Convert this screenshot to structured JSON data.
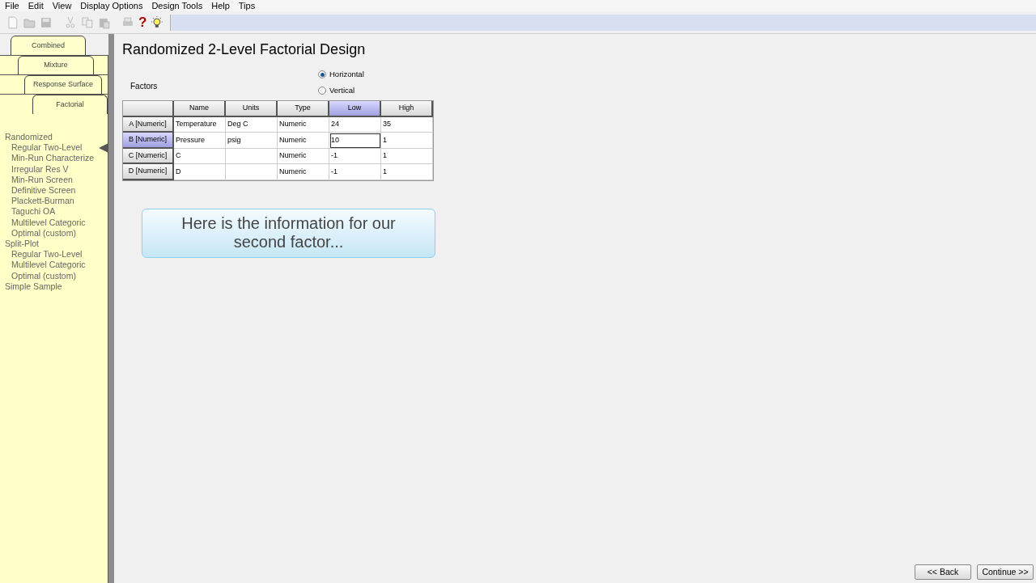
{
  "menu": [
    "File",
    "Edit",
    "View",
    "Display Options",
    "Design Tools",
    "Help",
    "Tips"
  ],
  "toolbar": [
    {
      "kind": "new",
      "disabled": true
    },
    {
      "kind": "open",
      "disabled": true
    },
    {
      "kind": "save",
      "disabled": true
    },
    {
      "kind": "cut",
      "disabled": true
    },
    {
      "kind": "copy",
      "disabled": true
    },
    {
      "kind": "paste",
      "disabled": true
    },
    {
      "kind": "print",
      "disabled": true
    },
    {
      "kind": "help",
      "disabled": false,
      "text": "?"
    },
    {
      "kind": "tip",
      "disabled": false
    }
  ],
  "tabs": [
    {
      "label": "Combined",
      "selected": false
    },
    {
      "label": "Mixture",
      "selected": false
    },
    {
      "label": "Response Surface",
      "selected": false
    },
    {
      "label": "Factorial",
      "selected": true
    }
  ],
  "sidebar": {
    "items": [
      {
        "label": "Randomized",
        "selected": false,
        "children": [
          {
            "label": "Regular Two-Level",
            "selected": true
          },
          {
            "label": "Min-Run Characterize",
            "selected": false
          },
          {
            "label": "Irregular Res V",
            "selected": false
          },
          {
            "label": "Min-Run Screen",
            "selected": false
          },
          {
            "label": "Definitive Screen",
            "selected": false
          },
          {
            "label": "Plackett-Burman",
            "selected": false
          },
          {
            "label": "Taguchi OA",
            "selected": false
          },
          {
            "label": "Multilevel Categoric",
            "selected": false
          },
          {
            "label": "Optimal (custom)",
            "selected": false
          }
        ]
      },
      {
        "label": "Split-Plot",
        "selected": false,
        "children": [
          {
            "label": "Regular Two-Level",
            "selected": false
          },
          {
            "label": "Multilevel Categoric",
            "selected": false
          },
          {
            "label": "Optimal (custom)",
            "selected": false
          }
        ]
      },
      {
        "label": "Simple Sample",
        "selected": false
      }
    ]
  },
  "title": "Randomized 2-Level Factorial Design",
  "factors_label": "Factors",
  "orientation": [
    {
      "label": "Horizontal",
      "selected": true
    },
    {
      "label": "Vertical",
      "selected": false
    }
  ],
  "table": {
    "columns": [
      {
        "label": "Name",
        "selected": false
      },
      {
        "label": "Units",
        "selected": false
      },
      {
        "label": "Type",
        "selected": false
      },
      {
        "label": "Low",
        "selected": true
      },
      {
        "label": "High",
        "selected": false
      }
    ],
    "rows": [
      {
        "header": "A [Numeric]",
        "selected": false,
        "cells": [
          {
            "text": "Temperature",
            "editing": false
          },
          {
            "text": "Deg C",
            "editing": false
          },
          {
            "text": "Numeric",
            "editing": false
          },
          {
            "text": "24",
            "editing": false
          },
          {
            "text": "35",
            "editing": false
          }
        ]
      },
      {
        "header": "B [Numeric]",
        "selected": true,
        "cells": [
          {
            "text": "Pressure",
            "editing": false
          },
          {
            "text": "psig",
            "editing": false
          },
          {
            "text": "Numeric",
            "editing": false
          },
          {
            "text": "10",
            "editing": true
          },
          {
            "text": "1",
            "editing": false
          }
        ]
      },
      {
        "header": "C [Numeric]",
        "selected": false,
        "cells": [
          {
            "text": "C",
            "editing": false
          },
          {
            "text": "",
            "editing": false
          },
          {
            "text": "Numeric",
            "editing": false
          },
          {
            "text": "-1",
            "editing": false
          },
          {
            "text": "1",
            "editing": false
          }
        ]
      },
      {
        "header": "D [Numeric]",
        "selected": false,
        "cells": [
          {
            "text": "D",
            "editing": false
          },
          {
            "text": "",
            "editing": false
          },
          {
            "text": "Numeric",
            "editing": false
          },
          {
            "text": "-1",
            "editing": false
          },
          {
            "text": "1",
            "editing": false
          }
        ]
      }
    ]
  },
  "callout": "Here is the information for our second factor...",
  "buttons": [
    "<< Back",
    "Continue >>"
  ]
}
